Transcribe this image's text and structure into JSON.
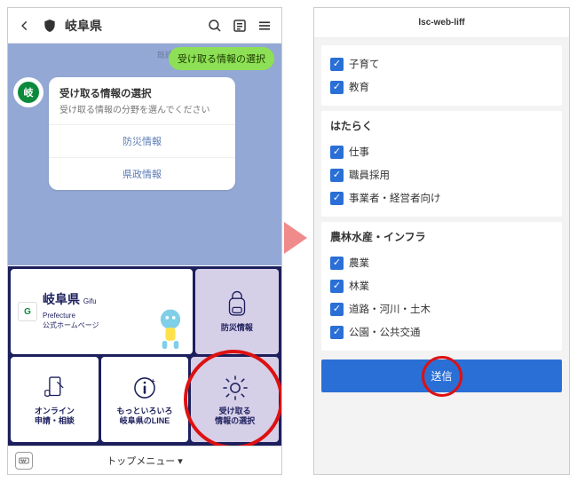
{
  "left": {
    "header_title": "岐阜県",
    "timelabel": "既読",
    "bubble": "受け取る情報の選択",
    "avatar_text": "岐",
    "card": {
      "title": "受け取る情報の選択",
      "desc": "受け取る情報の分野を選んでください",
      "buttons": [
        "防災情報",
        "県政情報"
      ]
    },
    "rich_menu": {
      "hero_title": "岐阜県",
      "hero_sub_en": "Gifu\nPrefecture",
      "hero_sub": "公式ホームページ",
      "logo_text": "G",
      "cells": [
        {
          "label": "防災情報"
        },
        {
          "label": "オンライン\n申請・相談"
        },
        {
          "label": "もっといろいろ\n岐阜県のLINE"
        },
        {
          "label": "受け取る\n情報の選択"
        }
      ]
    },
    "footer": "トップメニュー ▾"
  },
  "right": {
    "header": "lsc-web-liff",
    "section_top_items": [
      "子育て",
      "教育"
    ],
    "sections": [
      {
        "title": "はたらく",
        "items": [
          "仕事",
          "職員採用",
          "事業者・経営者向け"
        ]
      },
      {
        "title": "農林水産・インフラ",
        "items": [
          "農業",
          "林業",
          "道路・河川・土木",
          "公園・公共交通"
        ]
      }
    ],
    "submit": "送信"
  }
}
